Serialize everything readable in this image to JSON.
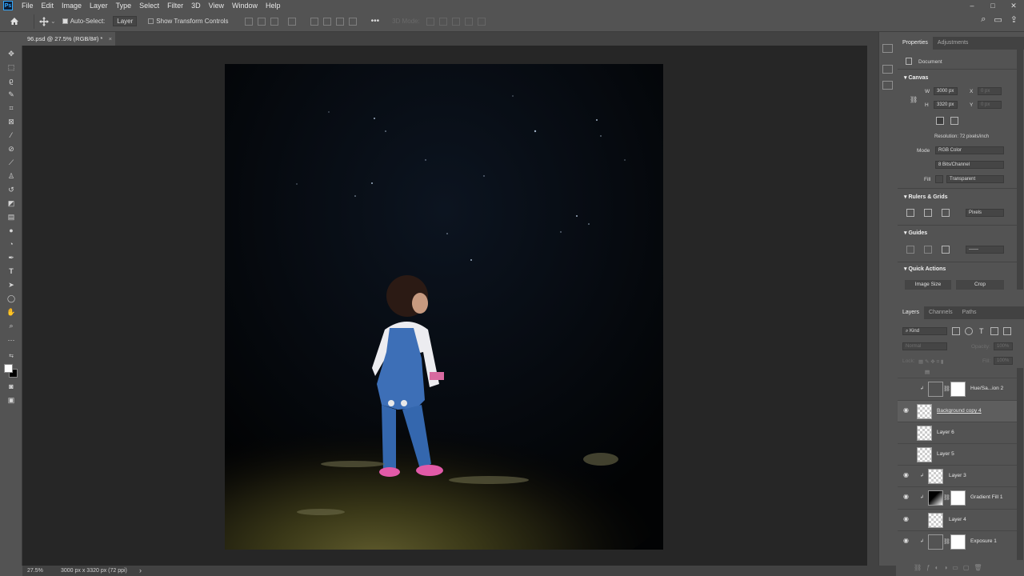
{
  "menu": {
    "logo": "Ps",
    "items": [
      "File",
      "Edit",
      "Image",
      "Layer",
      "Type",
      "Select",
      "Filter",
      "3D",
      "View",
      "Window",
      "Help"
    ]
  },
  "window_controls": [
    "–",
    "□",
    "✕"
  ],
  "options": {
    "auto_select_label": "Auto-Select:",
    "auto_select_value": "Layer",
    "transform_controls_label": "Show Transform Controls",
    "more": "•••",
    "mode_3d": "3D Mode:"
  },
  "document_tab": {
    "title": "96.psd @ 27.5% (RGB/8#) *",
    "close": "×"
  },
  "status": {
    "zoom": "27.5%",
    "size": "3000 px x 3320 px (72 ppi)",
    "arrow": "›"
  },
  "properties": {
    "tabs": [
      "Properties",
      "Adjustments"
    ],
    "doc_label": "Document",
    "canvas_section": "Canvas",
    "w_label": "W",
    "w_value": "3000 px",
    "h_label": "H",
    "h_value": "3320 px",
    "x_label": "X",
    "x_value": "0 px",
    "y_label": "Y",
    "y_value": "0 px",
    "resolution": "Resolution: 72 pixels/inch",
    "mode_label": "Mode",
    "mode_value": "RGB Color",
    "bits_value": "8 Bits/Channel",
    "fill_label": "Fill",
    "fill_value": "Transparent",
    "rulers_section": "Rulers & Grids",
    "rulers_unit": "Pixels",
    "guides_section": "Guides",
    "quick_actions_section": "Quick Actions",
    "image_size_btn": "Image Size",
    "crop_btn": "Crop"
  },
  "layers_panel": {
    "tabs": [
      "Layers",
      "Channels",
      "Paths"
    ],
    "kind": "Kind",
    "blend_mode": "Normal",
    "opacity_label": "Opacity:",
    "opacity_value": "100%",
    "lock_label": "Lock:",
    "fill_label": "Fill:",
    "fill_value": "100%",
    "layers": [
      {
        "name": "Hue/Sa...ion 2",
        "visible": false,
        "type": "adjustment"
      },
      {
        "name": "Background copy 4",
        "visible": true,
        "type": "pixel"
      },
      {
        "name": "Layer 6",
        "visible": false,
        "type": "pixel"
      },
      {
        "name": "Layer 5",
        "visible": false,
        "type": "pixel"
      },
      {
        "name": "Layer 3",
        "visible": true,
        "type": "pixel"
      },
      {
        "name": "Gradient Fill 1",
        "visible": true,
        "type": "adjustment"
      },
      {
        "name": "Layer 4",
        "visible": true,
        "type": "pixel"
      },
      {
        "name": "Exposure 1",
        "visible": true,
        "type": "adjustment"
      }
    ]
  },
  "icons": {
    "eye": "eye-icon",
    "search": "search-icon",
    "home": "home-icon",
    "move": "move-tool-icon"
  }
}
